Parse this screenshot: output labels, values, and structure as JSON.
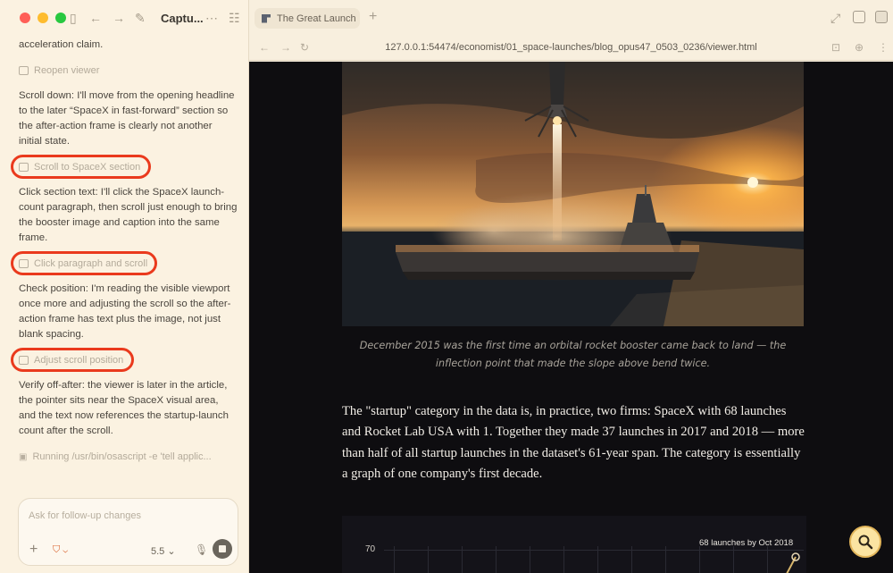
{
  "sidebar": {
    "title": "Captu...",
    "messages": [
      {
        "text": "acceleration claim."
      },
      {
        "text": "Scroll down: I'll move from the opening headline to the later “SpaceX in fast-forward” section so the after-action frame is clearly not another initial state."
      },
      {
        "text": "Click section text: I'll click the SpaceX launch-count paragraph, then scroll just enough to bring the booster image and caption into the same frame."
      },
      {
        "text": "Check position: I'm reading the visible viewport once more and adjusting the scroll so the after-action frame has text plus the image, not just blank spacing."
      },
      {
        "text": "Verify off-after: the viewer is later in the article, the pointer sits near the SpaceX visual area, and the text now references the startup-launch count after the scroll."
      }
    ],
    "tools": [
      {
        "label": "Reopen viewer"
      },
      {
        "label": "Scroll to SpaceX section"
      },
      {
        "label": "Click paragraph and scroll"
      },
      {
        "label": "Adjust scroll position"
      },
      {
        "label": "Running /usr/bin/osascript -e 'tell applic..."
      }
    ],
    "composer": {
      "placeholder": "Ask for follow-up changes",
      "model": "5.5"
    }
  },
  "browser": {
    "tab_title": "The Great Launch",
    "url": "127.0.0.1:54474/economist/01_space-launches/blog_opus47_0503_0236/viewer.html"
  },
  "article": {
    "caption": "December 2015 was the first time an orbital rocket booster came back to land — the inflection point that made the slope above bend twice.",
    "paragraph": "The \"startup\" category in the data is, in practice, two firms: SpaceX with 68 launches and Rocket Lab USA with 1. Together they made 37 launches in 2017 and 2018 — more than half of all startup launches in the dataset's 61-year span. The category is essentially a graph of one company's first decade.",
    "chart_y_tick": "70",
    "chart_annotation": "68 launches by Oct 2018"
  },
  "colors": {
    "highlight": "#ea3a1d",
    "page_bg": "#0e0d10",
    "sidebar_bg": "#fbf2e1"
  }
}
